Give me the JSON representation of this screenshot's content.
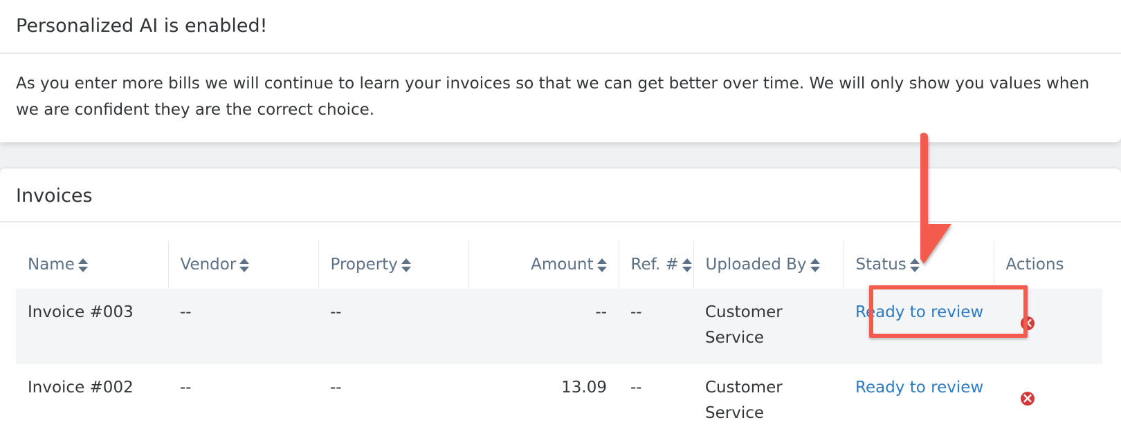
{
  "ai_notice": {
    "title": "Personalized AI is enabled!",
    "body_line1": "As you enter more bills we will continue to learn your invoices so that we can get better over time. We will only show you values when",
    "body_line2": "we are confident they are the correct choice."
  },
  "invoices": {
    "title": "Invoices",
    "columns": {
      "name": "Name",
      "vendor": "Vendor",
      "property": "Property",
      "amount": "Amount",
      "ref": "Ref. #",
      "uploaded_by": "Uploaded By",
      "status": "Status",
      "actions": "Actions"
    },
    "rows": [
      {
        "name": "Invoice #003",
        "vendor": "--",
        "property": "--",
        "amount": "--",
        "ref": "--",
        "uploaded_by_line1": "Customer",
        "uploaded_by_line2": "Service",
        "status": "Ready to review",
        "action_icon": "remove-circle-icon"
      },
      {
        "name": "Invoice #002",
        "vendor": "--",
        "property": "--",
        "amount": "13.09",
        "ref": "--",
        "uploaded_by_line1": "Customer",
        "uploaded_by_line2": "Service",
        "status": "Ready to review",
        "action_icon": "remove-circle-icon"
      }
    ]
  },
  "colors": {
    "link": "#2d7bc4",
    "header_text": "#5d7186",
    "annotation": "#f35b4e",
    "remove_icon": "#d33b3b"
  }
}
